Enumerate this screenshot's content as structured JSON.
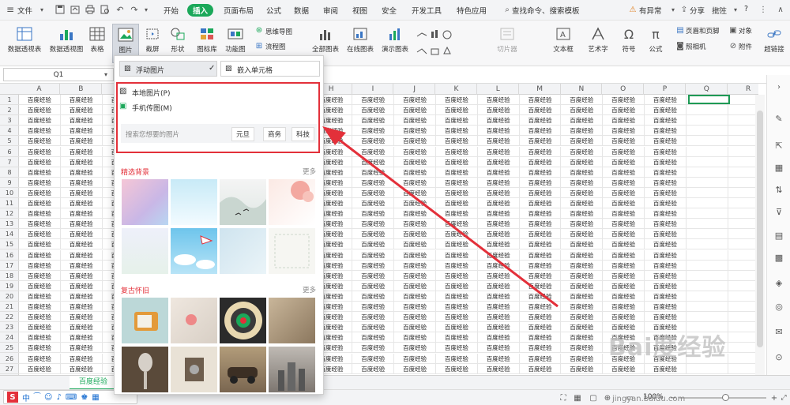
{
  "menubar": {
    "file": "文件",
    "tabs": [
      "开始",
      "插入",
      "页面布局",
      "公式",
      "数据",
      "审阅",
      "视图",
      "安全",
      "开发工具",
      "特色应用"
    ],
    "search_placeholder": "查找命令、搜索模板",
    "status_alert": "有异常",
    "share": "分享",
    "comment": "批注",
    "help": "?"
  },
  "ribbon": {
    "items": [
      "数据透视表",
      "数据透视图",
      "表格",
      "图片",
      "截屏",
      "形状",
      "图标库",
      "功能图",
      "全部图表",
      "在线图表",
      "演示图表",
      "切片器",
      "文本框",
      "艺术字",
      "符号",
      "公式",
      "附件",
      "超链接"
    ],
    "small": [
      "思维导图",
      "流程图",
      "页眉和页脚",
      "对象",
      "照相机"
    ]
  },
  "formula_bar": {
    "name_box": "Q1"
  },
  "grid": {
    "columns": [
      "A",
      "B",
      "C",
      "D",
      "E",
      "F",
      "G",
      "H",
      "I",
      "J",
      "K",
      "L",
      "M",
      "N",
      "O",
      "P",
      "Q",
      "R"
    ],
    "rows": [
      "1",
      "2",
      "3",
      "4",
      "5",
      "6",
      "7",
      "8",
      "9",
      "10",
      "11",
      "12",
      "13",
      "14",
      "15",
      "16",
      "17",
      "18",
      "19",
      "20",
      "21",
      "22",
      "23",
      "24",
      "25",
      "26",
      "27"
    ],
    "cell_text": "百度经验"
  },
  "picture_dropdown": {
    "tab_floating": "浮动图片",
    "tab_embed": "嵌入单元格",
    "local_picture": "本地图片(P)",
    "phone_picture": "手机传图(M)",
    "search_placeholder": "搜索您想要的图片",
    "tags": [
      "元旦",
      "商务",
      "科技"
    ],
    "section1_title": "精选背景",
    "section2_title": "复古怀旧",
    "more": "更多"
  },
  "sheet_tabs": {
    "active": "百度经验"
  },
  "status": {
    "zoom": "100%"
  },
  "ime": {
    "label": "中"
  },
  "watermark": {
    "text": "Bai度经验",
    "url": "jingyan.baidu.com"
  },
  "colors": {
    "accent": "#1ba85a",
    "highlight": "#e3303a"
  }
}
